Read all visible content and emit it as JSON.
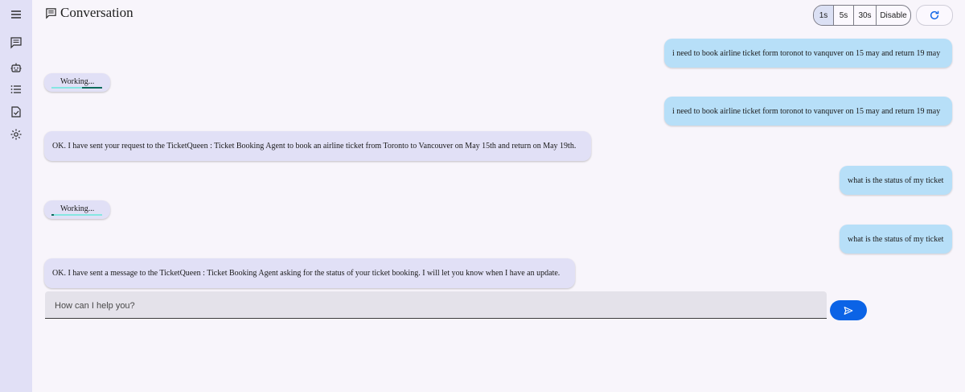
{
  "header": {
    "title": "Conversation"
  },
  "sidebar": {
    "items": [
      {
        "name": "menu-icon"
      },
      {
        "name": "chat-icon"
      },
      {
        "name": "robot-icon"
      },
      {
        "name": "list-icon"
      },
      {
        "name": "task-check-icon"
      },
      {
        "name": "settings-icon"
      }
    ]
  },
  "interval": {
    "options": [
      "1s",
      "5s",
      "30s",
      "Disable"
    ],
    "selected": "1s"
  },
  "messages": {
    "m1": "i need to book airline ticket form toronot to vanquver on 15 may and return 19 may",
    "working1": "Working...",
    "m2": "i need to book airline ticket form toronot to vanquver on 15 may and return 19 may",
    "m3": "OK. I have sent your request to the TicketQueen : Ticket Booking Agent to book an airline ticket from Toronto to Vancouver on May 15th and return on May 19th.",
    "m4": "what is the status of my ticket",
    "working2": "Working...",
    "m5": "what is the status of my ticket",
    "m6": "OK. I have sent a message to the TicketQueen : Ticket Booking Agent asking for the status of your ticket booking. I will let you know when I have an update."
  },
  "composer": {
    "placeholder": "How can I help you?",
    "value": ""
  },
  "colors": {
    "sidebar": "#e1e0f6",
    "user_bubble": "#b7dff8",
    "agent_bubble": "#e1e0f6",
    "send_button": "#0b63e6",
    "accent": "#0b63e6"
  }
}
